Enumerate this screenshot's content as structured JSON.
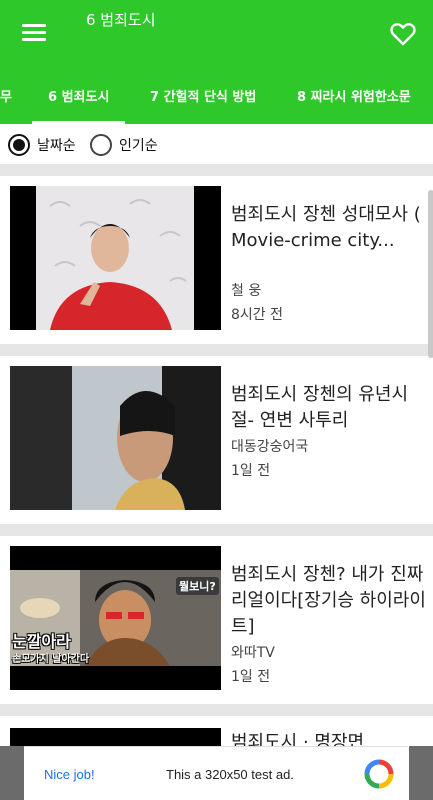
{
  "header": {
    "title": "6 범죄도시",
    "menu_icon": "menu-icon",
    "favorite_icon": "heart-icon"
  },
  "tabs": [
    {
      "label": "무"
    },
    {
      "label": "6 범죄도시"
    },
    {
      "label": "7 간헐적 단식 방법"
    },
    {
      "label": "8 찌라시 위험한소문"
    }
  ],
  "sort": {
    "options": [
      "날짜순",
      "인기순"
    ],
    "selected": "날짜순"
  },
  "videos": [
    {
      "title": "범죄도시 장첸 성대모사 ( Movie-crime city...",
      "channel": "철 웅",
      "time": "8시간 전"
    },
    {
      "title": "범죄도시 장첸의 유년시절- 연변 사투리",
      "channel": "대동강숭어국",
      "time": "1일 전"
    },
    {
      "title": "범죄도시 장첸? 내가 진짜 리얼이다[장기승 하이라이트]",
      "channel": "와따TV",
      "time": "1일 전"
    },
    {
      "title": "범죄도시 · 명장면"
    }
  ],
  "thumb_text": {
    "v3_bubble": "뭘보니?",
    "v3_caption_1": "눈깔아라",
    "v3_caption_2": "손모가지 날아간다"
  },
  "ad": {
    "nice_job": "Nice job!",
    "text": "This a 320x50 test ad."
  },
  "colors": {
    "primary": "#2ec82b",
    "ad_link": "#1a73e8"
  }
}
